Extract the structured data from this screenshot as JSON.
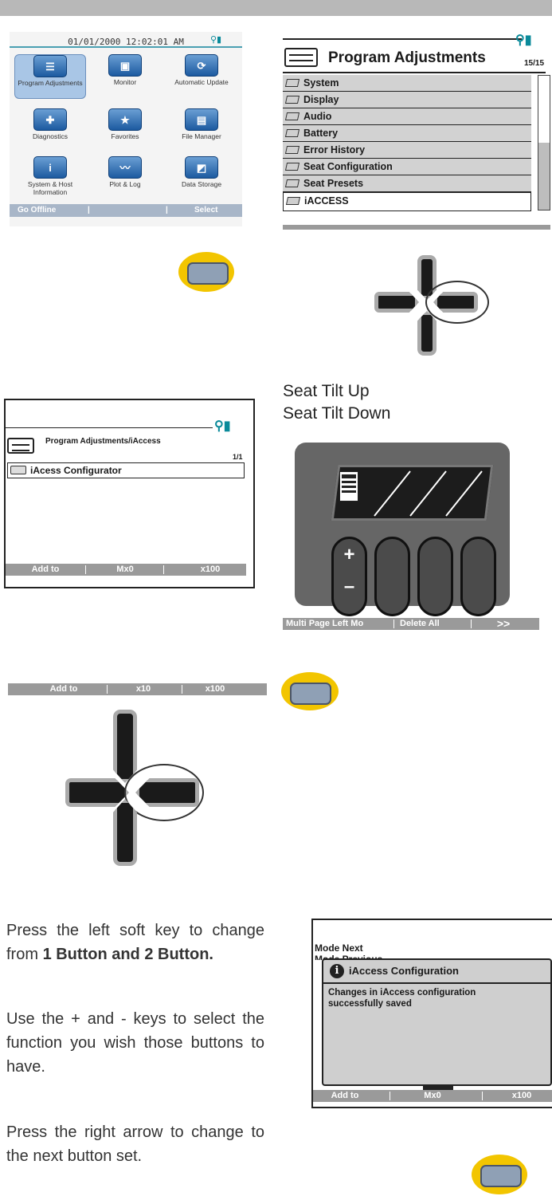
{
  "panel_home": {
    "datetime": "01/01/2000  12:02:01 AM",
    "tiles": [
      {
        "label": "Program Adjustments",
        "icon": "sliders-icon"
      },
      {
        "label": "Monitor",
        "icon": "monitor-icon"
      },
      {
        "label": "Automatic Update",
        "icon": "update-icon"
      },
      {
        "label": "Diagnostics",
        "icon": "diagnostics-icon"
      },
      {
        "label": "Favorites",
        "icon": "favorites-icon"
      },
      {
        "label": "File Manager",
        "icon": "file-manager-icon"
      },
      {
        "label": "System & Host Information",
        "icon": "info-icon"
      },
      {
        "label": "Plot & Log",
        "icon": "plot-icon"
      },
      {
        "label": "Data Storage",
        "icon": "storage-icon"
      }
    ],
    "footer_left": "Go Offline",
    "footer_right": "Select"
  },
  "panel_program": {
    "title": "Program Adjustments",
    "page": "15/15",
    "items": [
      "System",
      "Display",
      "Audio",
      "Battery",
      "Error History",
      "Seat Configuration",
      "Seat Presets",
      "iACCESS"
    ]
  },
  "seat_labels": {
    "line1": "Seat Tilt Up",
    "line2": "Seat Tilt Down"
  },
  "panel_iaccess": {
    "title": "Program Adjustments/iAccess",
    "page": "1/1",
    "item": "iAcess Configurator",
    "footer": [
      "Add to",
      "Mx0",
      "x100"
    ]
  },
  "device_bar": {
    "left": "Multi Page Left Mo",
    "middle": "Delete All",
    "right": ">>"
  },
  "key_bar": [
    "Add to",
    "x10",
    "x100"
  ],
  "instructions": {
    "p1_a": "Press the left soft key to change from ",
    "p1_b": "1 Button and 2 Button.",
    "p2": "Use the + and - keys to select the function you wish those buttons to have.",
    "p3": "Press the right arrow to change to the next button set."
  },
  "panel_saved": {
    "mode_next": "Mode Next",
    "mode_prev": "Mode Previous",
    "dialog_title": "iAccess Configuration",
    "dialog_msg": "Changes in iAccess configuration successfully saved",
    "footer": [
      "Add to",
      "Mx0",
      "x100"
    ]
  },
  "colors": {
    "key_yellow": "#f2c500",
    "bar_gray": "#9a9a9a",
    "tile_blue": "#1c5aa0"
  }
}
